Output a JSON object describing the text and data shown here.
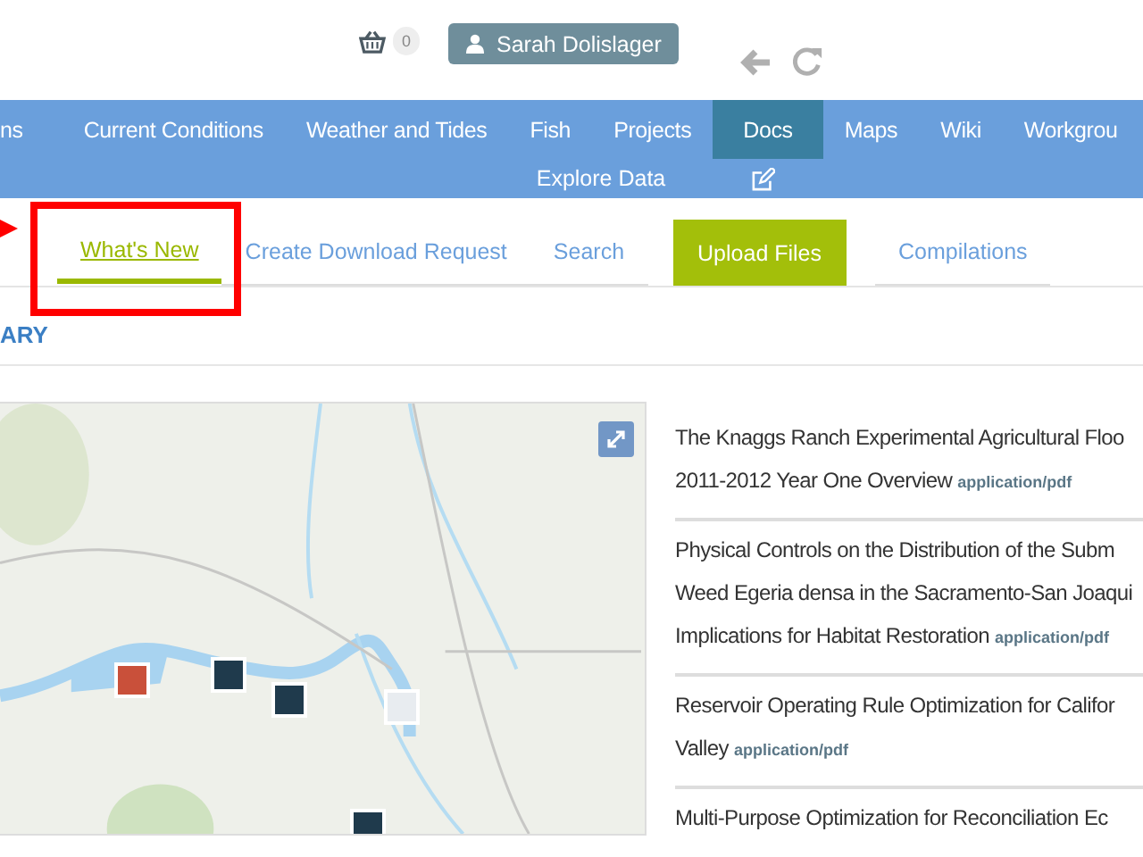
{
  "header": {
    "cart_count": "0",
    "user": "Sarah Dolislager"
  },
  "nav": {
    "items": [
      {
        "label": "ns",
        "selected": false
      },
      {
        "label": "Current Conditions",
        "selected": false
      },
      {
        "label": "Weather and Tides",
        "selected": false
      },
      {
        "label": "Fish",
        "selected": false
      },
      {
        "label": "Projects",
        "selected": false
      },
      {
        "label": "Docs",
        "selected": true
      },
      {
        "label": "Maps",
        "selected": false
      },
      {
        "label": "Wiki",
        "selected": false
      },
      {
        "label": "Workgrou",
        "selected": false
      }
    ],
    "second_row": {
      "label": "Explore Data"
    }
  },
  "subtabs": [
    {
      "label": "What's New",
      "selected": true,
      "kind": "tab"
    },
    {
      "label": "Create Download Request",
      "selected": false,
      "kind": "tab"
    },
    {
      "label": "Search",
      "selected": false,
      "kind": "tab"
    },
    {
      "label": "Upload Files",
      "selected": false,
      "kind": "button"
    },
    {
      "label": "Compilations",
      "selected": false,
      "kind": "tab"
    }
  ],
  "section_title": "ARY",
  "documents": [
    {
      "lines": [
        "The Knaggs Ranch Experimental Agricultural Floo",
        "2011-2012 Year One Overview"
      ],
      "type": "application/pdf"
    },
    {
      "lines": [
        "Physical Controls on the Distribution of the Subm",
        "Weed Egeria densa in the Sacramento-San Joaqui",
        "Implications for Habitat Restoration"
      ],
      "type": "application/pdf"
    },
    {
      "lines": [
        "Reservoir Operating Rule Optimization for Califor",
        "Valley"
      ],
      "type": "application/pdf"
    },
    {
      "lines": [
        "Multi-Purpose Optimization for Reconciliation Ec"
      ]
    }
  ]
}
